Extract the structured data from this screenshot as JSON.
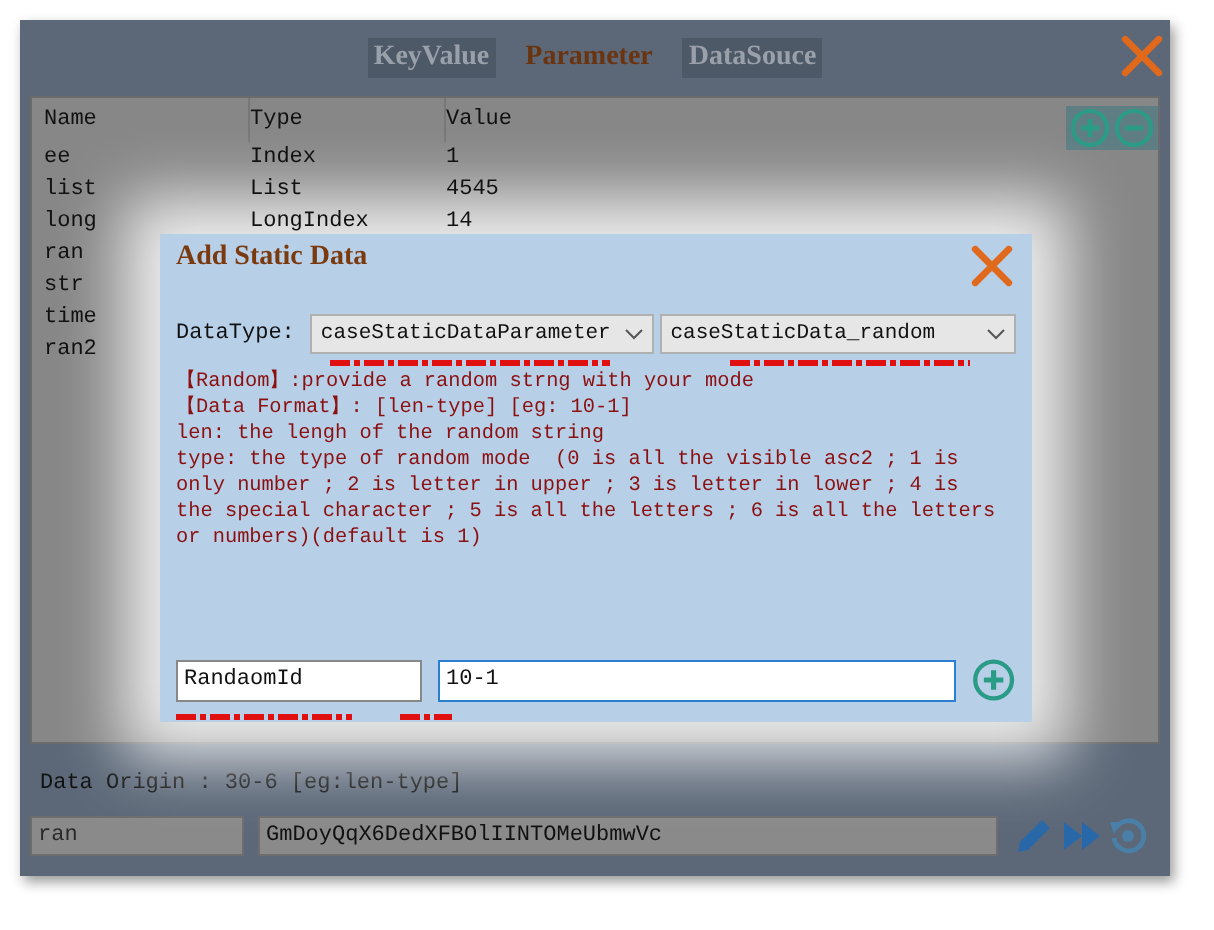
{
  "tabs": [
    {
      "label": "KeyValue",
      "selected": false
    },
    {
      "label": "Parameter",
      "selected": true
    },
    {
      "label": "DataSouce",
      "selected": false
    }
  ],
  "table": {
    "columns": [
      "Name",
      "Type",
      "Value"
    ],
    "rows": [
      {
        "name": "ee",
        "type": "Index",
        "value": "1"
      },
      {
        "name": "list",
        "type": "List",
        "value": "4545"
      },
      {
        "name": "long",
        "type": "LongIndex",
        "value": "14"
      },
      {
        "name": "ran"
      },
      {
        "name": "str"
      },
      {
        "name": "time"
      },
      {
        "name": "ran2"
      }
    ]
  },
  "dialog": {
    "title": "Add Static Data",
    "datatype_label": "DataType:",
    "dropdowns": [
      "caseStaticDataParameter",
      "caseStaticData_random"
    ],
    "help_lines": [
      "【Random】:provide a random strng with your mode",
      "【Data Format】: [len-type] [eg: 10-1]",
      "len: the lengh of the random string",
      "type: the type of random mode  (0 is all the visible asc2 ; 1 is",
      "only number ; 2 is letter in upper ; 3 is letter in lower ; 4 is",
      "the special character ; 5 is all the letters ; 6 is all the letters",
      "or numbers)(default is 1)"
    ],
    "name_field": {
      "value": "RandaomId"
    },
    "format_field": {
      "value": "10-1"
    }
  },
  "data_origin": "Data Origin : 30-6 [eg:len-type]",
  "bottom_name_field": {
    "value": "ran"
  },
  "bottom_value_field": {
    "value": "GmDoyQqX6DedXFBOlIINTOMeUbmwVc"
  }
}
